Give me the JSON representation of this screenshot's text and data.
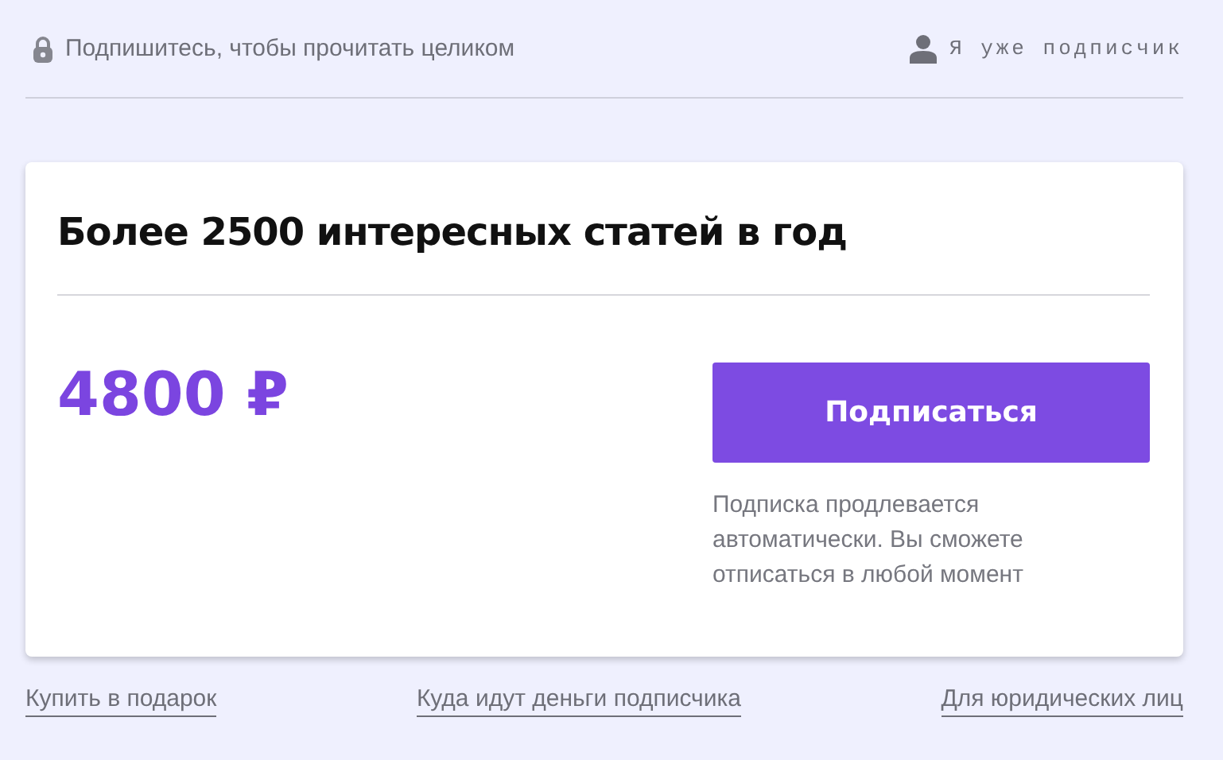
{
  "top_bar": {
    "paywall_note": "Подпишитесь, чтобы прочитать целиком",
    "login_link": "Я уже подписчик"
  },
  "card": {
    "title": "Более 2500 интересных статей в год",
    "price": "4800 ₽",
    "subscribe_button": "Подписаться",
    "renewal_note": "Подписка продлевается автоматически. Вы сможете отписаться в любой момент"
  },
  "footer_links": [
    "Купить в подарок",
    "Куда идут деньги подписчика",
    "Для юридических лиц"
  ]
}
